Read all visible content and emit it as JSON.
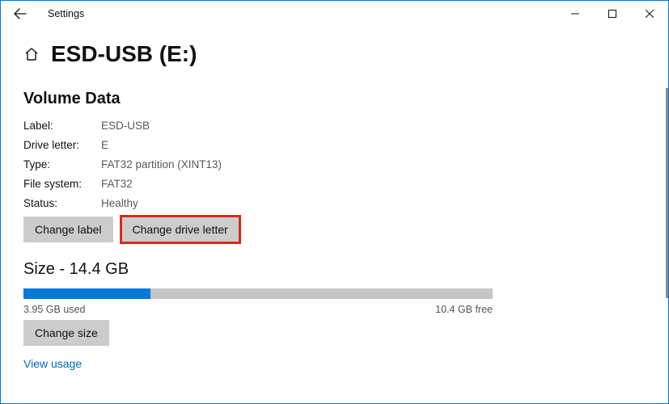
{
  "window": {
    "title": "Settings"
  },
  "page": {
    "title": "ESD-USB (E:)"
  },
  "volume": {
    "heading": "Volume Data",
    "rows": {
      "label_k": "Label:",
      "label_v": "ESD-USB",
      "driveletter_k": "Drive letter:",
      "driveletter_v": "E",
      "type_k": "Type:",
      "type_v": "FAT32 partition (XINT13)",
      "fs_k": "File system:",
      "fs_v": "FAT32",
      "status_k": "Status:",
      "status_v": "Healthy"
    },
    "buttons": {
      "change_label": "Change label",
      "change_drive_letter": "Change drive letter"
    }
  },
  "size": {
    "heading": "Size - 14.4 GB",
    "used_label": "3.95 GB used",
    "free_label": "10.4 GB free",
    "fill_percent": 27,
    "change_size": "Change size",
    "view_usage": "View usage"
  }
}
